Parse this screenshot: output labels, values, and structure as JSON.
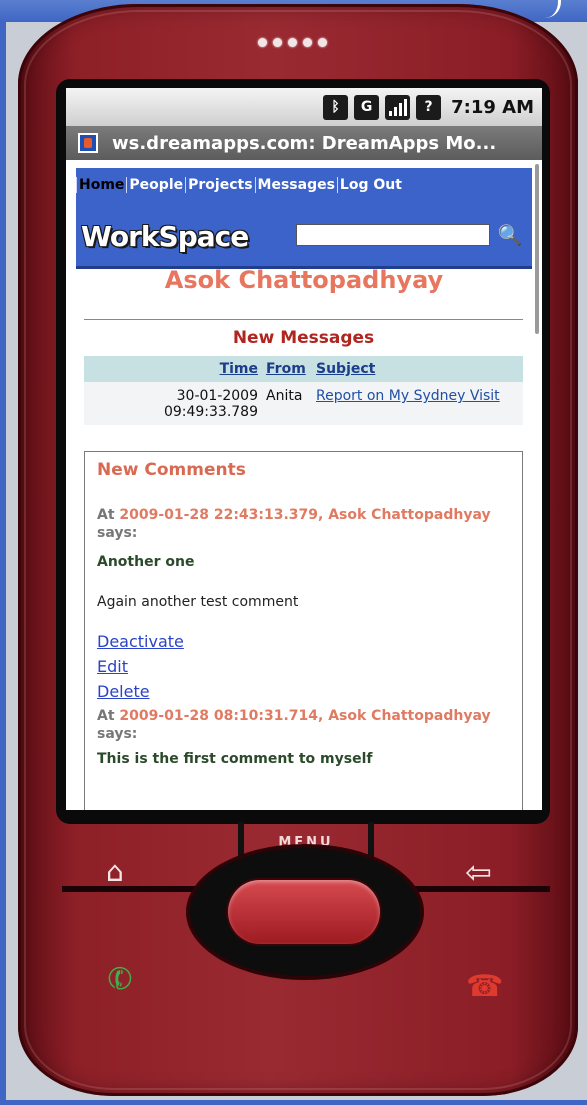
{
  "phone": {
    "menu_key_label": "MENU",
    "keys": {
      "home_glyph": "⌂",
      "back_glyph": "⇦",
      "call_glyph": "✆",
      "end_glyph": "☎"
    }
  },
  "status_bar": {
    "time": "7:19 AM",
    "icons": [
      "bluetooth-icon",
      "network-icon",
      "signal-icon",
      "help-icon"
    ],
    "bluetooth_glyph": "ᛒ",
    "network_glyph": "G",
    "help_glyph": "?"
  },
  "browser": {
    "title": "ws.dreamapps.com: DreamApps Mo..."
  },
  "nav": {
    "items": [
      {
        "label": "Home",
        "current": true
      },
      {
        "label": "People"
      },
      {
        "label": "Projects"
      },
      {
        "label": "Messages"
      },
      {
        "label": "Log Out"
      }
    ]
  },
  "header": {
    "logo": "WorkSpace",
    "search_value": "",
    "search_icon": "🔍"
  },
  "person": {
    "name": "Asok Chattopadhyay"
  },
  "new_messages": {
    "title": "New Messages",
    "columns": [
      "Time",
      "From",
      "Subject"
    ],
    "rows": [
      {
        "time_date": "30-01-2009",
        "time_clock": "09:49:33.789",
        "from": "Anita",
        "subject": "Report on My Sydney Visit"
      }
    ]
  },
  "new_comments": {
    "title": "New Comments",
    "comments": [
      {
        "prefix": "At",
        "timestamp_author": "2009-01-28 22:43:13.379, Asok Chattopadhyay",
        "suffix": "says:",
        "heading": "Another one",
        "body": "Again another test comment",
        "links": [
          "Deactivate",
          "Edit",
          "Delete"
        ]
      },
      {
        "prefix": "At",
        "timestamp_author": "2009-01-28 08:10:31.714, Asok Chattopadhyay",
        "suffix": "says:",
        "heading": "This is the first comment to myself"
      }
    ]
  },
  "colors": {
    "phone_body": "#8d1f27",
    "header_blue": "#3b63c9",
    "name_salmon": "#e8755e",
    "messages_title": "#b0251f",
    "table_header_bg": "#c7e0e2",
    "link_blue": "#2b43c7"
  }
}
